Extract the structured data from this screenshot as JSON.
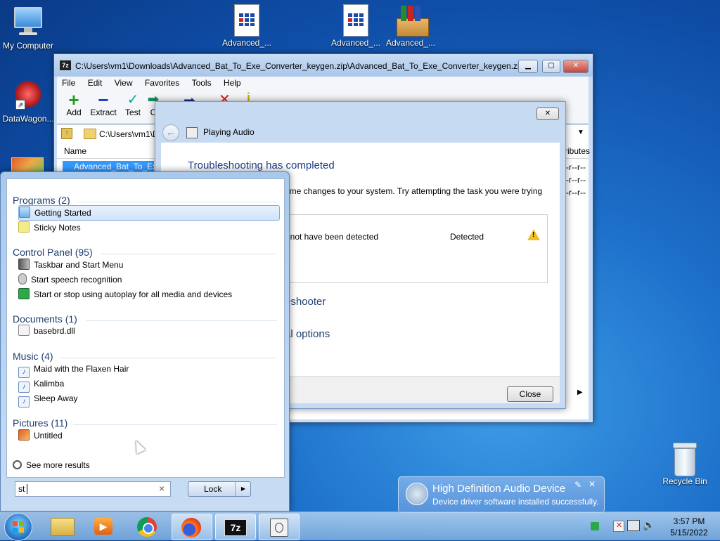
{
  "desktop": {
    "icons": [
      {
        "label": "My Computer"
      },
      {
        "label": "DataWagon..."
      },
      {
        "label": "Advanced_..."
      },
      {
        "label": "Advanced_..."
      },
      {
        "label": "Advanced_..."
      },
      {
        "label": "Recycle Bin"
      }
    ]
  },
  "sevenzip": {
    "title": "C:\\Users\\vm1\\Downloads\\Advanced_Bat_To_Exe_Converter_keygen.zip\\Advanced_Bat_To_Exe_Converter_keygen.zip\\",
    "app_icon": "7z",
    "menu": [
      "File",
      "Edit",
      "View",
      "Favorites",
      "Tools",
      "Help"
    ],
    "toolbar": [
      {
        "label": "Add",
        "icon": "+"
      },
      {
        "label": "Extract",
        "icon": "−"
      },
      {
        "label": "Test",
        "icon": "✓"
      },
      {
        "label": "C",
        "icon": "➡"
      }
    ],
    "address": "C:\\Users\\vm1\\D",
    "columns": {
      "name": "Name",
      "attributes": "ributes"
    },
    "rows": [
      {
        "name": "Advanced_Bat_To_Exe",
        "attr": "-r--r--"
      },
      {
        "attr": "-r--r--"
      },
      {
        "attr": "-r--r--"
      }
    ]
  },
  "troubleshooter": {
    "title": "Playing Audio",
    "heading": "Troubleshooting has completed",
    "desc": "ome changes to your system. Try attempting the task you were trying",
    "issue": "t not have been detected",
    "status": "Detected",
    "link1": "eshooter",
    "link2": "al options",
    "close_label": "Close"
  },
  "startmenu": {
    "categories": [
      {
        "title": "Programs (2)",
        "items": [
          "Getting Started",
          "Sticky Notes"
        ]
      },
      {
        "title": "Control Panel (95)",
        "items": [
          "Taskbar and Start Menu",
          "Start speech recognition",
          "Start or stop using autoplay for all media and devices"
        ]
      },
      {
        "title": "Documents (1)",
        "items": [
          "basebrd.dll"
        ]
      },
      {
        "title": "Music (4)",
        "items": [
          "Maid with the Flaxen Hair",
          "Kalimba",
          "Sleep Away"
        ]
      },
      {
        "title": "Pictures (11)",
        "items": [
          "Untitled"
        ]
      }
    ],
    "see_more": "See more results",
    "search_value": "st",
    "clear_symbol": "×",
    "lock_label": "Lock"
  },
  "notification": {
    "title": "High Definition Audio Device",
    "body": "Device driver software installed successfully."
  },
  "taskbar": {
    "sevenzip_label": "7z",
    "clock_time": "3:57 PM",
    "clock_date": "5/15/2022"
  }
}
